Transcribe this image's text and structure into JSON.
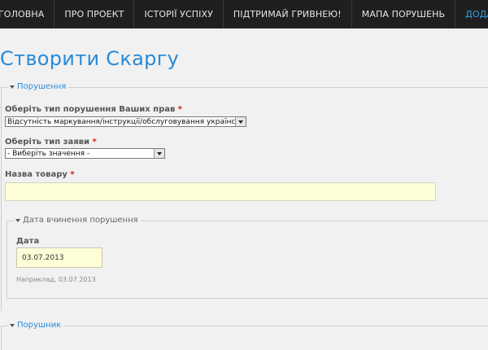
{
  "nav": {
    "items": [
      {
        "label": "ГОЛОВНА"
      },
      {
        "label": "ПРО ПРОЕКТ"
      },
      {
        "label": "ІСТОРІЇ УСПІХУ"
      },
      {
        "label": "ПІДТРИМАЙ ГРИВНЕЮ!"
      },
      {
        "label": "МАПА ПОРУШЕНЬ"
      },
      {
        "label": "ДОДАТИ СКАРГУ"
      }
    ],
    "active_color": "#3aa0e8"
  },
  "page": {
    "title": "Створити Скаргу",
    "title_color": "#2a8ad6"
  },
  "violations": {
    "legend": "Порушення",
    "rights_type_label": "Оберіть тип порушення Ваших прав",
    "rights_type_value": "Відсутність маркування/інструкції/обслуговування українською",
    "request_type_label": "Оберіть тип заяви",
    "request_type_value": "- Виберіть значення -",
    "product_name_label": "Назва товару",
    "product_name_value": "",
    "required_mark": "*"
  },
  "date_group": {
    "legend": "Дата вчинення порушення",
    "date_label": "Дата",
    "date_value": "03.07.2013",
    "date_hint": "Наприклад, 03.07.2013"
  },
  "violator": {
    "legend": "Порушник"
  }
}
